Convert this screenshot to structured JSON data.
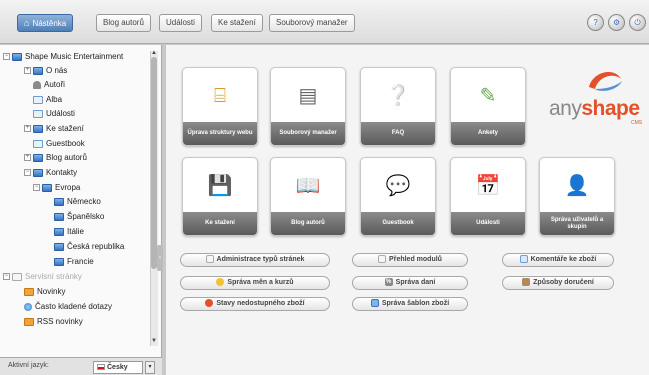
{
  "toolbar": {
    "tabs": [
      {
        "label": "Nástěnka",
        "active": true
      },
      {
        "label": "Blog autorů"
      },
      {
        "label": "Události"
      },
      {
        "label": "Ke stažení"
      },
      {
        "label": "Souborový manažer"
      }
    ]
  },
  "sidebar": {
    "tree": [
      {
        "label": "Shape Music Entertainment",
        "icon": "folder-icon"
      },
      {
        "label": "O nás",
        "icon": "folder-icon"
      },
      {
        "label": "Autoři",
        "icon": "user-icon"
      },
      {
        "label": "Alba",
        "icon": "document-icon"
      },
      {
        "label": "Události",
        "icon": "document-icon"
      },
      {
        "label": "Ke stažení",
        "icon": "folder-icon"
      },
      {
        "label": "Guestbook",
        "icon": "document-icon"
      },
      {
        "label": "Blog autorů",
        "icon": "folder-icon"
      },
      {
        "label": "Kontakty",
        "icon": "folder-icon"
      },
      {
        "label": "Evropa",
        "icon": "folder-icon"
      },
      {
        "label": "Německo",
        "icon": "folder-icon"
      },
      {
        "label": "Španělsko",
        "icon": "folder-icon"
      },
      {
        "label": "Itálie",
        "icon": "folder-icon"
      },
      {
        "label": "Česká republika",
        "icon": "folder-icon"
      },
      {
        "label": "Francie",
        "icon": "folder-icon"
      },
      {
        "label": "Servisní stránky",
        "icon": "page-icon"
      },
      {
        "label": "Novinky",
        "icon": "pencil-icon"
      },
      {
        "label": "Často kladené dotazy",
        "icon": "globe-icon"
      },
      {
        "label": "RSS novinky",
        "icon": "rss-icon"
      }
    ],
    "language_label": "Aktivní jazyk:",
    "language_value": "Česky"
  },
  "tiles": [
    {
      "label": "Úprava struktury webu",
      "icon": "structure-icon"
    },
    {
      "label": "Souborový manažer",
      "icon": "file-manager-icon"
    },
    {
      "label": "FAQ",
      "icon": "faq-icon"
    },
    {
      "label": "Ankety",
      "icon": "poll-icon"
    },
    {
      "label": "Ke stažení",
      "icon": "floppy-disk-icon"
    },
    {
      "label": "Blog autorů",
      "icon": "book-icon"
    },
    {
      "label": "Guestbook",
      "icon": "speech-bubbles-icon"
    },
    {
      "label": "Události",
      "icon": "calendar-icon"
    },
    {
      "label": "Správa uživatelů a skupin",
      "icon": "users-icon"
    }
  ],
  "logo": {
    "any": "any",
    "shape": "shape",
    "cms": "CMS"
  },
  "links": [
    {
      "label": "Administrace typů stránek"
    },
    {
      "label": "Přehled modulů"
    },
    {
      "label": "Komentáře ke zboží"
    },
    {
      "label": "Správa měn a kurzů"
    },
    {
      "label": "Správa daní"
    },
    {
      "label": "Způsoby doručení"
    },
    {
      "label": "Stavy nedostupného zboží"
    },
    {
      "label": "Správa šablon zboží"
    }
  ],
  "colors": {
    "accent": "#4d7fb8",
    "brand_orange": "#e2512a"
  }
}
